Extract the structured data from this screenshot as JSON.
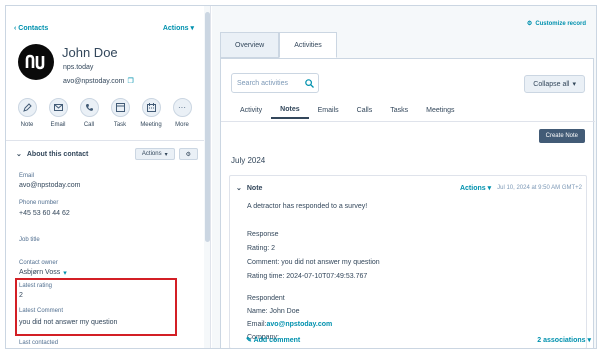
{
  "sidebar": {
    "back_label": "Contacts",
    "actions_label": "Actions",
    "contact": {
      "name": "John Doe",
      "company": "nps.today",
      "email": "avo@npstoday.com"
    },
    "quick_actions": [
      {
        "label": "Note",
        "icon": "note-icon"
      },
      {
        "label": "Email",
        "icon": "email-icon"
      },
      {
        "label": "Call",
        "icon": "call-icon"
      },
      {
        "label": "Task",
        "icon": "task-icon"
      },
      {
        "label": "Meeting",
        "icon": "meeting-icon"
      },
      {
        "label": "More",
        "icon": "more-icon"
      }
    ],
    "about": {
      "title": "About this contact",
      "actions_label": "Actions"
    },
    "properties": [
      {
        "label": "Email",
        "value": "avo@npstoday.com"
      },
      {
        "label": "Phone number",
        "value": "+45 53 60 44 62"
      },
      {
        "label": "Job title",
        "value": ""
      },
      {
        "label": "Contact owner",
        "value": "Asbjørn Voss"
      },
      {
        "label": "Latest rating",
        "value": "2"
      },
      {
        "label": "Latest Comment",
        "value": "you did not answer my question"
      },
      {
        "label": "Last contacted",
        "value": ""
      }
    ]
  },
  "main": {
    "customize_label": "Customize record",
    "tabs": [
      {
        "label": "Overview",
        "active": false
      },
      {
        "label": "Activities",
        "active": true
      }
    ],
    "search": {
      "placeholder": "Search activities"
    },
    "collapse_label": "Collapse all",
    "subtabs": [
      {
        "label": "Activity"
      },
      {
        "label": "Notes"
      },
      {
        "label": "Emails"
      },
      {
        "label": "Calls"
      },
      {
        "label": "Tasks"
      },
      {
        "label": "Meetings"
      }
    ],
    "create_note_label": "Create Note",
    "month_label": "July 2024",
    "note": {
      "type_label": "Note",
      "actions_label": "Actions",
      "timestamp": "Jul 10, 2024 at 9:50 AM GMT+2",
      "lines": [
        "A detractor has responded to a survey!",
        "",
        "Response",
        "Rating: 2",
        "Comment: you did not answer my question",
        "Rating time: 2024-07-10T07:49:53.767",
        "",
        "Respondent",
        "Name: John Doe",
        "Email:",
        "Company:"
      ],
      "email_link": "avo@npstoday.com",
      "add_comment_label": "Add comment",
      "associations_label": "2 associations"
    }
  },
  "colors": {
    "link": "#0091ae",
    "text": "#33475b",
    "highlight": "#d31f25",
    "primary_button": "#425b76"
  }
}
